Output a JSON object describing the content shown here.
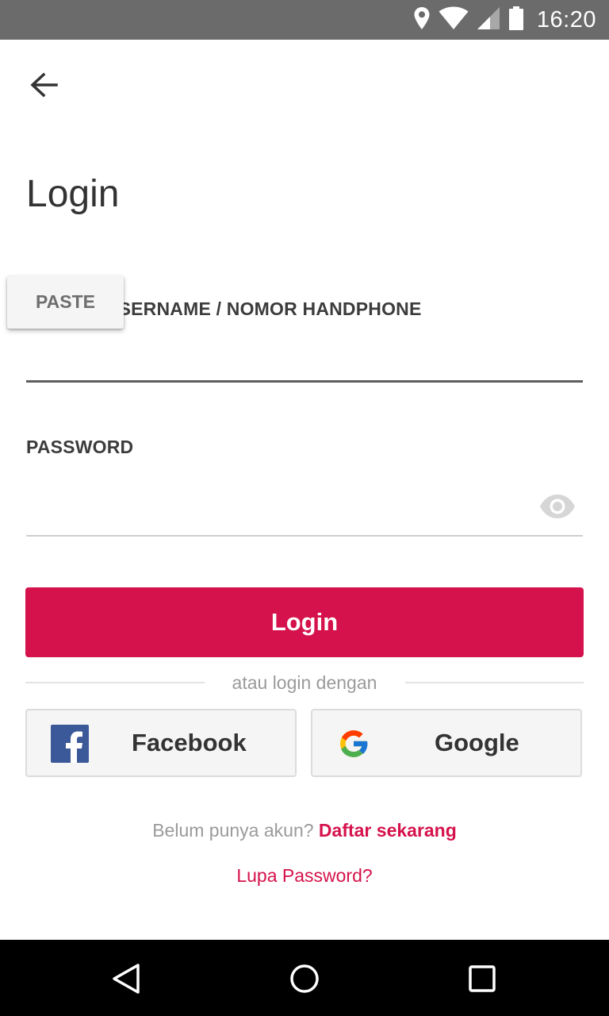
{
  "status_bar": {
    "time": "16:20",
    "icons": [
      "location-icon",
      "wifi-icon",
      "signal-icon",
      "battery-icon"
    ]
  },
  "header": {
    "back_icon": "arrow-left-icon"
  },
  "page": {
    "title": "Login"
  },
  "form": {
    "identity_label": "E-MAIL / USERNAME / NOMOR HANDPHONE",
    "identity_value": "",
    "password_label": "PASSWORD",
    "password_value": "",
    "password_toggle_icon": "eye-icon",
    "paste_label": "PASTE",
    "login_button": "Login"
  },
  "social": {
    "divider_text": "atau login dengan",
    "facebook_label": "Facebook",
    "google_label": "Google"
  },
  "footer": {
    "signup_prompt": "Belum punya akun?",
    "signup_link": "Daftar sekarang",
    "forgot_link": "Lupa Password?"
  },
  "colors": {
    "accent": "#d5124b",
    "status_bar": "#6b6b6b",
    "nav_bar": "#000000",
    "facebook": "#3b5998"
  },
  "nav_bar": {
    "icons": [
      "back-triangle-icon",
      "home-circle-icon",
      "recents-square-icon"
    ]
  }
}
